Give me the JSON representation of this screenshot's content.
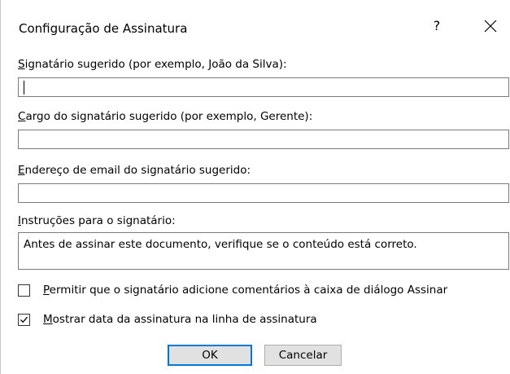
{
  "dialog": {
    "title": "Configuração de Assinatura",
    "help_label": "?",
    "close_icon": "close-icon"
  },
  "fields": {
    "signer_name": {
      "label_key": "S",
      "label_rest": "ignatário sugerido (por exemplo, João da Silva):",
      "value": ""
    },
    "signer_title": {
      "label_key": "C",
      "label_rest": "argo do signatário sugerido (por exemplo, Gerente):",
      "value": ""
    },
    "signer_email": {
      "label_key": "E",
      "label_rest": "ndereço de email do signatário sugerido:",
      "value": ""
    },
    "instructions": {
      "label_key": "I",
      "label_rest": "nstruções para o signatário:",
      "value": "Antes de assinar este documento, verifique se o conteúdo está correto."
    }
  },
  "options": {
    "allow_comments": {
      "label_key": "P",
      "label_rest": "ermitir que o signatário adicione comentários à caixa de diálogo Assinar",
      "checked": false
    },
    "show_date": {
      "label_key": "M",
      "label_rest": "ostrar data da assinatura na linha de assinatura",
      "checked": true
    }
  },
  "buttons": {
    "ok": "OK",
    "cancel": "Cancelar"
  },
  "colors": {
    "accent": "#0078d7",
    "button_face": "#e1e1e1",
    "field_border": "#7a7a7a"
  }
}
